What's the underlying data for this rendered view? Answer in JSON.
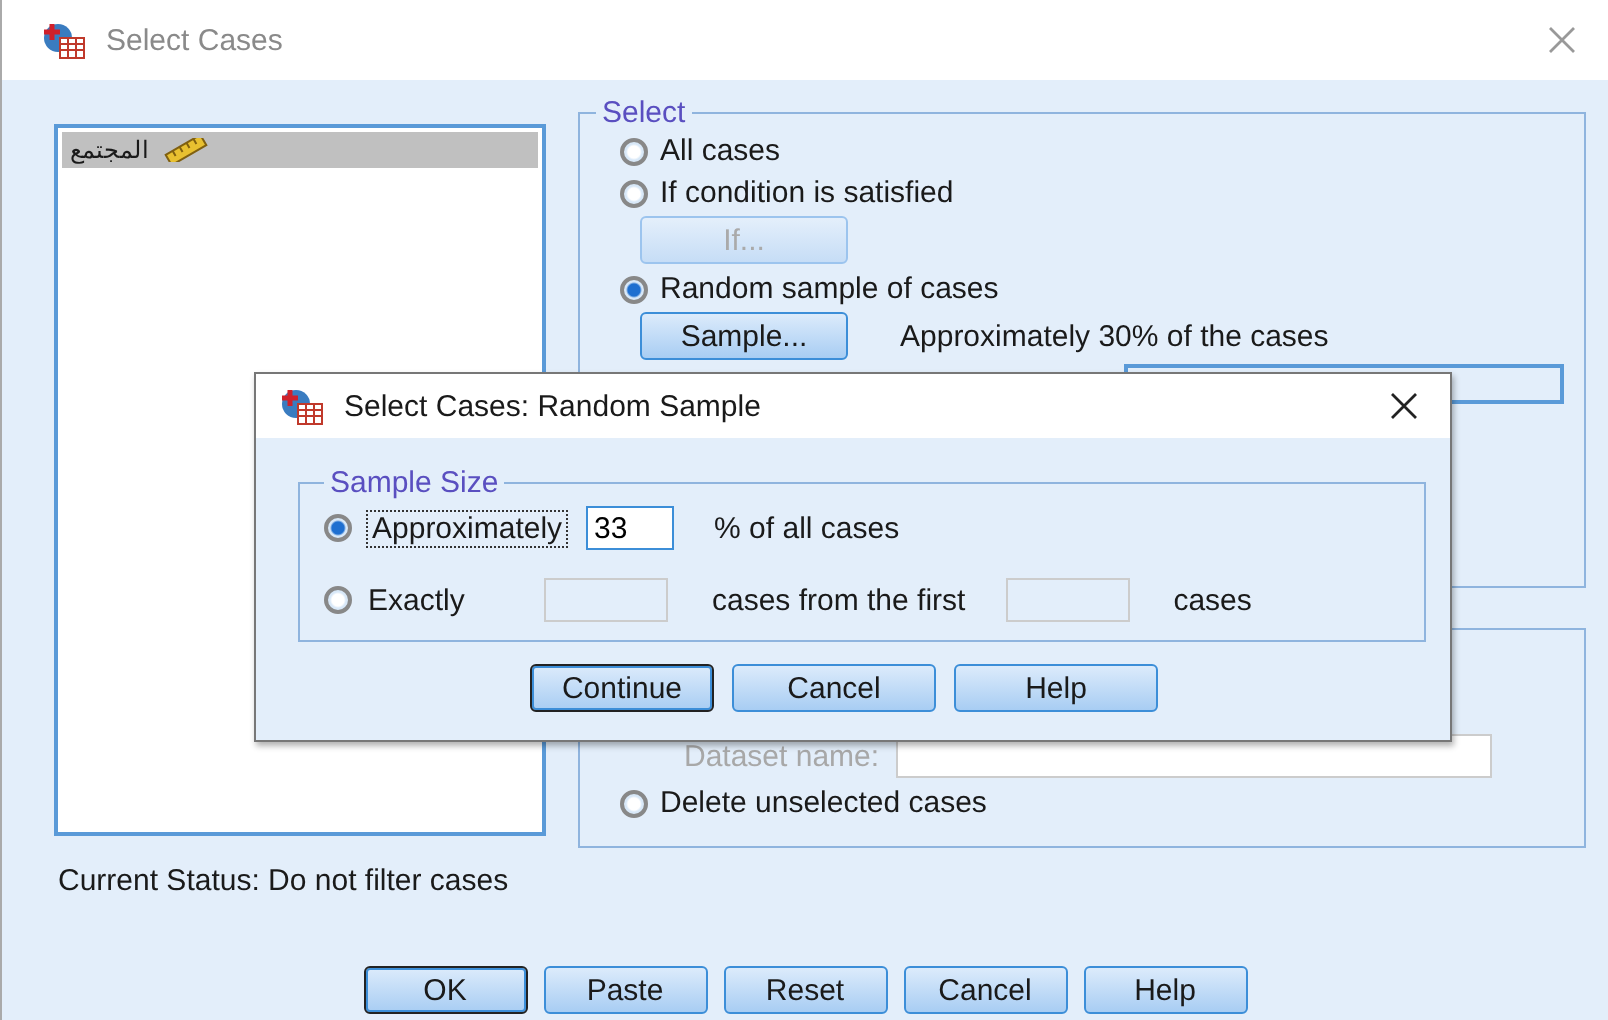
{
  "window": {
    "title": "Select Cases"
  },
  "variables": [
    {
      "name": "المجتمع",
      "selected": true
    }
  ],
  "select_group": {
    "title": "Select",
    "options": [
      {
        "kind": "radio",
        "label": "All cases",
        "selected": false
      },
      {
        "kind": "radio",
        "label": "If condition is satisfied",
        "selected": false
      },
      {
        "kind": "button",
        "label": "If...",
        "disabled": true
      },
      {
        "kind": "radio",
        "label": "Random sample of cases",
        "selected": true
      },
      {
        "kind": "button",
        "label": "Sample...",
        "disabled": false,
        "note": "Approximately 30% of the cases"
      }
    ]
  },
  "output_group": {
    "dataset_label": "Dataset name:",
    "dataset_disabled": true,
    "options": [
      {
        "label": "Delete unselected cases",
        "selected": false
      }
    ]
  },
  "status": "Current Status: Do not filter cases",
  "buttons": [
    {
      "label": "OK",
      "default": true
    },
    {
      "label": "Paste",
      "default": false
    },
    {
      "label": "Reset",
      "default": false
    },
    {
      "label": "Cancel",
      "default": false
    },
    {
      "label": "Help",
      "default": false
    }
  ],
  "dialog": {
    "title": "Select Cases: Random Sample",
    "group_title": "Sample Size",
    "rows": [
      {
        "kind": "percent",
        "label": "Approximately",
        "selected": true,
        "focused": true,
        "value": "33",
        "suffix": "% of all cases"
      },
      {
        "kind": "exact",
        "label": "Exactly",
        "selected": false,
        "focused": false,
        "middle": "cases from the first",
        "suffix": "cases"
      }
    ],
    "buttons": [
      {
        "label": "Continue",
        "default": true
      },
      {
        "label": "Cancel",
        "default": false
      },
      {
        "label": "Help",
        "default": false
      }
    ]
  }
}
